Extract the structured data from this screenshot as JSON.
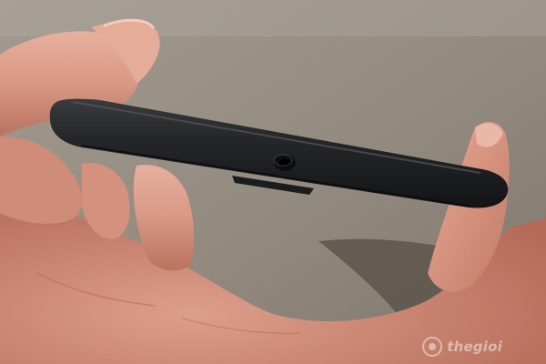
{
  "image": {
    "subject": "phone-side-profile-held-in-hand",
    "colors": {
      "background": "#8f8579",
      "phone_body": "#1d1e20",
      "skin": "#d99a86",
      "shadow": "#5b534b"
    }
  },
  "watermark": {
    "text": "thegioi",
    "icon": "watermark-logo-icon"
  }
}
